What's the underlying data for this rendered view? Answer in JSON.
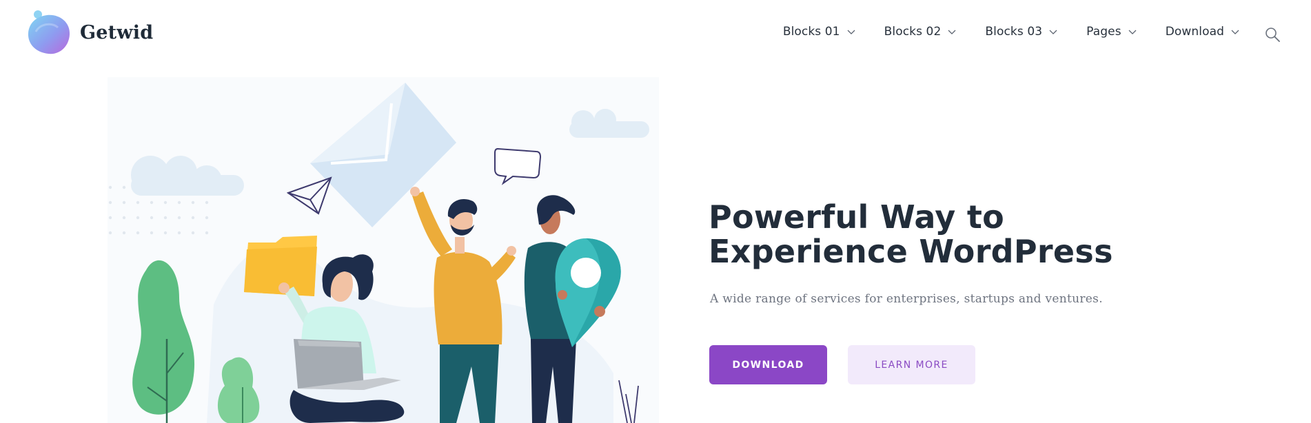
{
  "brand": {
    "name": "Getwid",
    "colors": {
      "blob_start": "#7fd6f2",
      "blob_end": "#b06ee0",
      "dot": "#8fd3f3"
    }
  },
  "nav": {
    "items": [
      {
        "label": "Blocks 01",
        "icon": "chevron-down-icon"
      },
      {
        "label": "Blocks 02",
        "icon": "chevron-down-icon"
      },
      {
        "label": "Blocks 03",
        "icon": "chevron-down-icon"
      },
      {
        "label": "Pages",
        "icon": "chevron-down-icon"
      },
      {
        "label": "Download",
        "icon": "chevron-down-icon"
      }
    ],
    "search_icon": "search-icon"
  },
  "hero": {
    "title": "Powerful Way to\nExperience WordPress",
    "subtitle": "A wide range of services for enterprises, startups and ventures.",
    "primary_button": "DOWNLOAD",
    "secondary_button": "LEARN MORE",
    "colors": {
      "accent": "#8b47c6",
      "accent_light": "#f2eafb",
      "title": "#222d3a",
      "subtitle": "#6e7480"
    }
  },
  "illustration": {
    "colors": {
      "cloud": "#e2edf6",
      "envelope": "#d6e6f5",
      "folder": "#ffc845",
      "sweater": "#ecac3a",
      "pants": "#1b5f6a",
      "pin": "#3dbdbd",
      "leaves": "#5dbe82",
      "laptop": "#a5abb2",
      "navy": "#1e2d4b"
    }
  }
}
